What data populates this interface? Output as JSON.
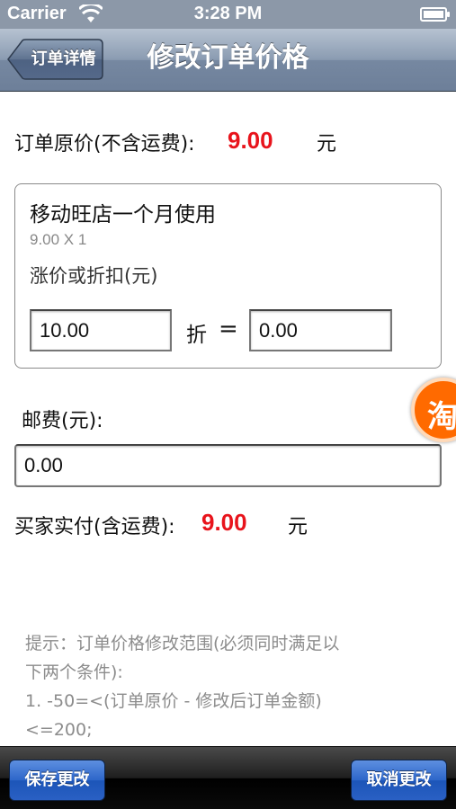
{
  "status_bar": {
    "carrier": "Carrier",
    "time": "3:28 PM"
  },
  "nav": {
    "back_label": "订单详情",
    "title": "修改订单价格"
  },
  "original_price": {
    "label": "订单原价(不含运费):",
    "value": "9.00",
    "unit": "元"
  },
  "item": {
    "name": "移动旺店一个月使用",
    "qty_text": "9.00 X 1",
    "discount_label": "涨价或折扣(元)",
    "discount_value": "10.00",
    "discount_unit": "折",
    "equals": "=",
    "result_value": "0.00"
  },
  "postage": {
    "label": "邮费(元):",
    "value": "0.00"
  },
  "buyer_pay": {
    "label": "买家实付(含运费):",
    "value": "9.00",
    "unit": "元"
  },
  "hint": {
    "line1": "提示：订单价格修改范围(必须同时满足以",
    "line2": "下两个条件):",
    "line3": "1. -50=<(订单原价 - 修改后订单金额)",
    "line4": "<=200;"
  },
  "badge_text": "淘",
  "toolbar": {
    "save_label": "保存更改",
    "cancel_label": "取消更改"
  },
  "colors": {
    "accent_red": "#e8141c",
    "nav_blue": "#7688a1",
    "button_blue": "#2d66c9",
    "badge_orange": "#ff6a00"
  }
}
